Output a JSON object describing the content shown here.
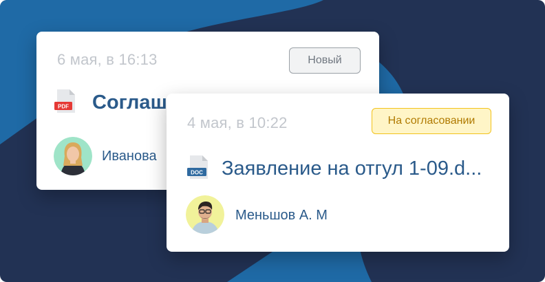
{
  "colors": {
    "background": "#223254",
    "accent_blue": "#1f6aa6",
    "title_blue": "#2a5a8a",
    "date_gray": "#c2c6cc",
    "badge_new_border": "#9aa0a6",
    "badge_approve_bg": "#fff5c7",
    "badge_approve_border": "#f2c21b",
    "pdf_red": "#e53935",
    "doc_blue": "#2f6aa0"
  },
  "cards": [
    {
      "date": "6 мая, в 16:13",
      "status": "Новый",
      "file_type": "PDF",
      "file_icon": "pdf-file-icon",
      "title": "Соглаш",
      "author": "Иванова",
      "avatar_icon": "avatar-woman-icon"
    },
    {
      "date": "4 мая, в 10:22",
      "status": "На согласовании",
      "file_type": "DOC",
      "file_icon": "doc-file-icon",
      "title": "Заявление на отгул 1-09.d...",
      "author": "Меньшов А. М",
      "avatar_icon": "avatar-man-icon"
    }
  ]
}
